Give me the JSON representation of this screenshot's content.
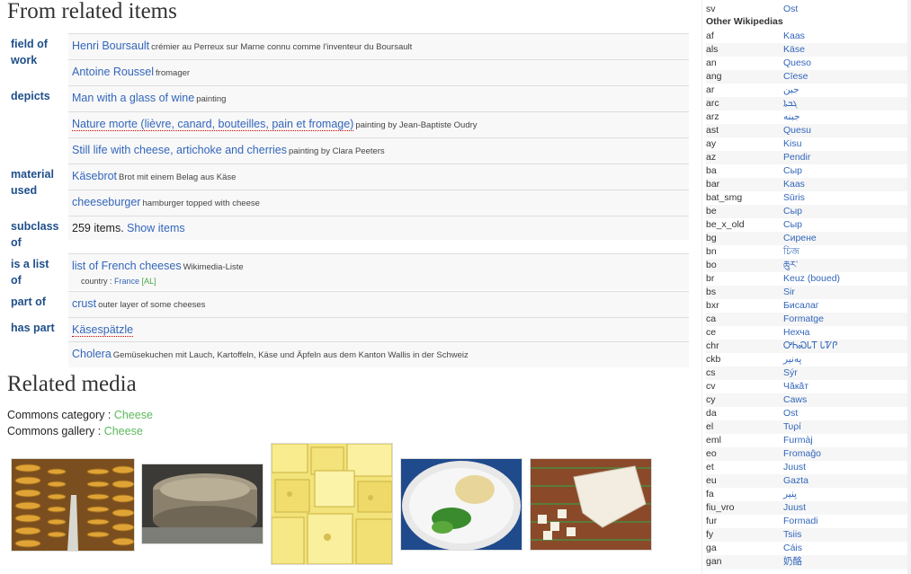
{
  "headings": {
    "related_items": "From related items",
    "related_media": "Related media"
  },
  "relations": [
    {
      "prop": [
        "field of",
        "work"
      ],
      "items": [
        {
          "link": "Henri Boursault",
          "desc": "crémier au Perreux sur Marne connu comme l'inventeur du Boursault"
        },
        {
          "link": "Antoine Roussel",
          "desc": "fromager"
        }
      ]
    },
    {
      "prop": [
        "depicts"
      ],
      "items": [
        {
          "link": "Man with a glass of wine",
          "desc": "painting"
        },
        {
          "link": "Nature morte (lièvre, canard, bouteilles, pain et fromage)",
          "desc": "painting by Jean-Baptiste Oudry",
          "missing": true
        },
        {
          "link": "Still life with cheese, artichoke and cherries",
          "desc": "painting by Clara Peeters"
        }
      ]
    },
    {
      "prop": [
        "material",
        "used"
      ],
      "items": [
        {
          "link": "Käsebrot",
          "desc": "Brot mit einem Belag aus Käse"
        },
        {
          "link": "cheeseburger",
          "desc": "hamburger topped with cheese"
        }
      ]
    },
    {
      "prop": [
        "subclass",
        "of"
      ],
      "items": [
        {
          "plain": "259 items.",
          "link": "Show items",
          "desc": ""
        }
      ]
    },
    {
      "prop": [
        "is a list",
        "of"
      ],
      "items": [
        {
          "link": "list of French cheeses",
          "desc": "Wikimedia-Liste",
          "sub_label": "country :",
          "sub_link": "France",
          "sub_extra": "AL"
        }
      ]
    },
    {
      "prop": [
        "part of"
      ],
      "items": [
        {
          "link": "crust",
          "desc": "outer layer of some cheeses"
        }
      ]
    },
    {
      "prop": [
        "has part"
      ],
      "items": [
        {
          "link": "Käsespätzle",
          "desc": "",
          "missing": true
        },
        {
          "link": "Cholera",
          "desc": "Gemüsekuchen mit Lauch, Kartoffeln, Käse und Äpfeln aus dem Kanton Wallis in der Schweiz"
        }
      ]
    }
  ],
  "commons": {
    "category_label": "Commons category :",
    "category_link": "Cheese",
    "gallery_label": "Commons gallery :",
    "gallery_link": "Cheese"
  },
  "sidebar": {
    "top_row": {
      "code": "sv",
      "name": "Ost"
    },
    "heading": "Other Wikipedias",
    "rows": [
      {
        "code": "af",
        "name": "Kaas"
      },
      {
        "code": "als",
        "name": "Käse"
      },
      {
        "code": "an",
        "name": "Queso"
      },
      {
        "code": "ang",
        "name": "Cīese"
      },
      {
        "code": "ar",
        "name": "جبن"
      },
      {
        "code": "arc",
        "name": "ܓܒܬܐ"
      },
      {
        "code": "arz",
        "name": "جبنه"
      },
      {
        "code": "ast",
        "name": "Quesu"
      },
      {
        "code": "ay",
        "name": "Kisu"
      },
      {
        "code": "az",
        "name": "Pendir"
      },
      {
        "code": "ba",
        "name": "Сыр"
      },
      {
        "code": "bar",
        "name": "Kaas"
      },
      {
        "code": "bat_smg",
        "name": "Sūris"
      },
      {
        "code": "be",
        "name": "Сыр"
      },
      {
        "code": "be_x_old",
        "name": "Сыр"
      },
      {
        "code": "bg",
        "name": "Сирене"
      },
      {
        "code": "bn",
        "name": "চিজ"
      },
      {
        "code": "bo",
        "name": "ཆུར་"
      },
      {
        "code": "br",
        "name": "Keuz (boued)"
      },
      {
        "code": "bs",
        "name": "Sir"
      },
      {
        "code": "bxr",
        "name": "Бисалаг"
      },
      {
        "code": "ca",
        "name": "Formatge"
      },
      {
        "code": "ce",
        "name": "Нехча"
      },
      {
        "code": "chr",
        "name": "ᎤᏂᏍᏓᎢ ᏓᏤᎵ"
      },
      {
        "code": "ckb",
        "name": "پەنیر"
      },
      {
        "code": "cs",
        "name": "Sýr"
      },
      {
        "code": "cv",
        "name": "Чăкăт"
      },
      {
        "code": "cy",
        "name": "Caws"
      },
      {
        "code": "da",
        "name": "Ost"
      },
      {
        "code": "el",
        "name": "Τυρί"
      },
      {
        "code": "eml",
        "name": "Furmàj"
      },
      {
        "code": "eo",
        "name": "Fromaĝo"
      },
      {
        "code": "et",
        "name": "Juust"
      },
      {
        "code": "eu",
        "name": "Gazta"
      },
      {
        "code": "fa",
        "name": "پنیر"
      },
      {
        "code": "fiu_vro",
        "name": "Juust"
      },
      {
        "code": "fur",
        "name": "Formadi"
      },
      {
        "code": "fy",
        "name": "Tsiis"
      },
      {
        "code": "ga",
        "name": "Cáis"
      },
      {
        "code": "gan",
        "name": "奶酪"
      }
    ]
  }
}
